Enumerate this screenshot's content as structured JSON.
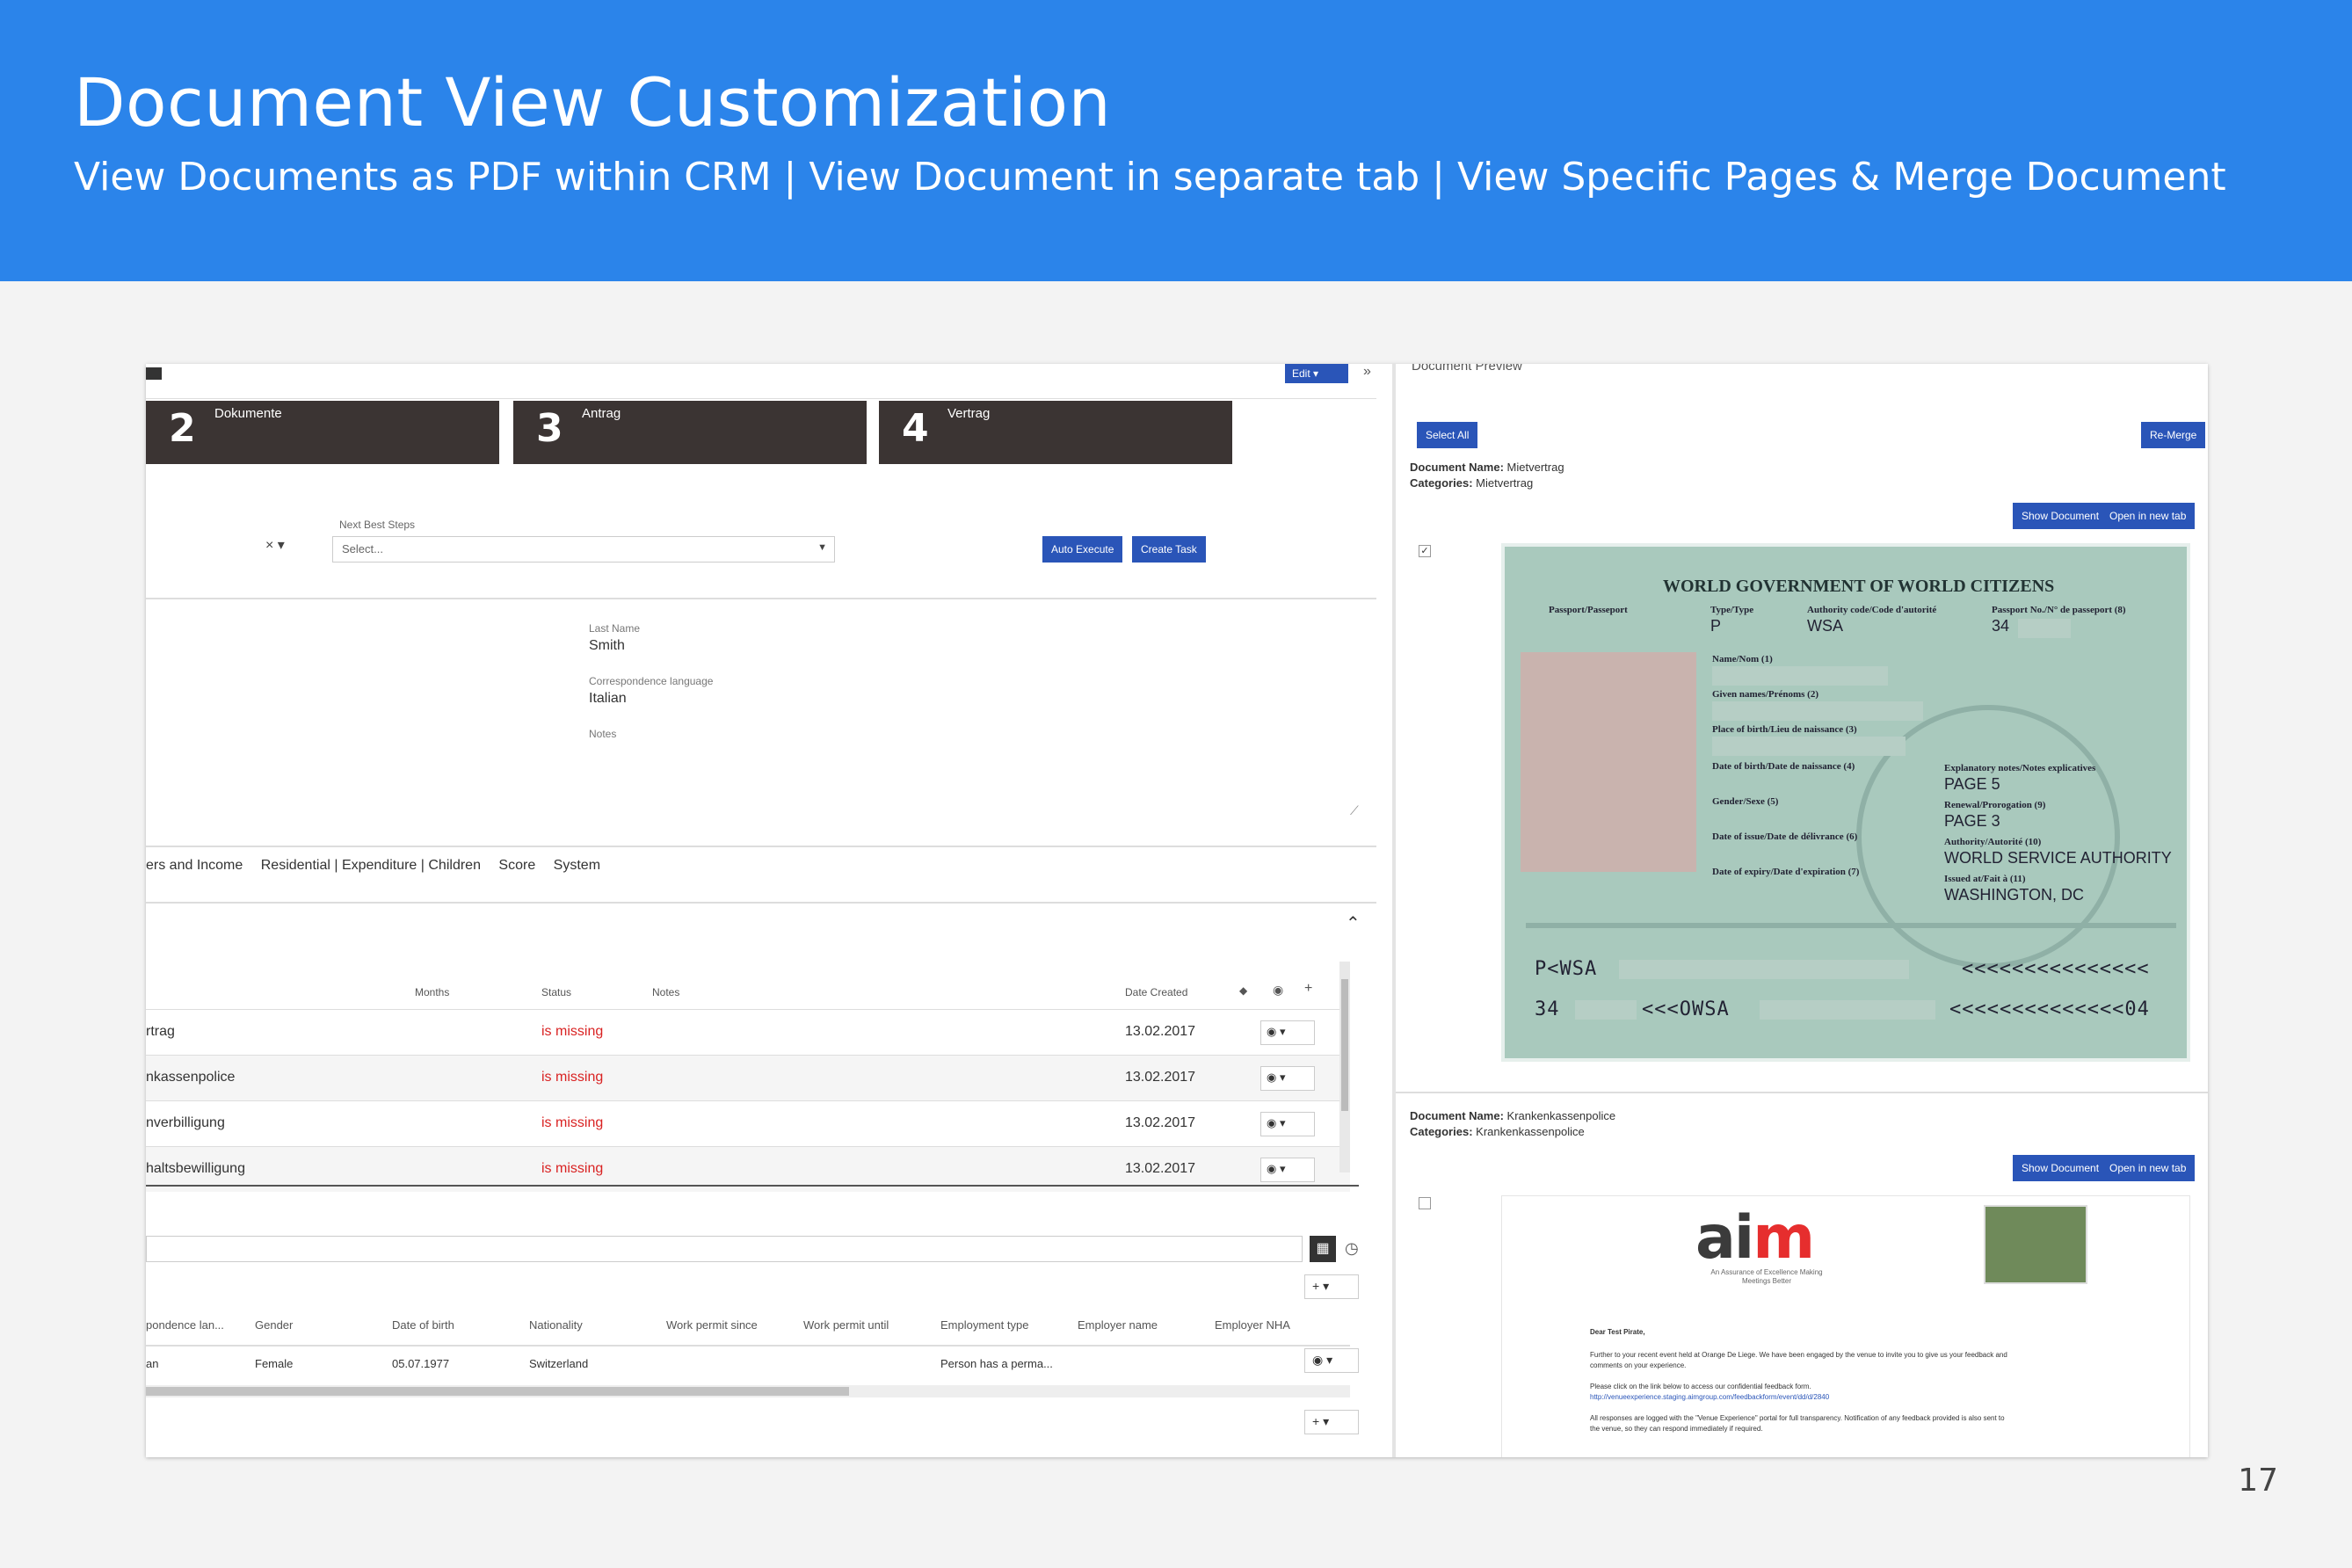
{
  "slide": {
    "title": "Document View Customization",
    "subtitle": "View Documents as PDF within CRM | View Document in separate tab | View Specific Pages & Merge Document",
    "page_number": "17",
    "accent_color": "#2b84ea"
  },
  "crm": {
    "top_bar": {
      "edit_label": "Edit",
      "expand_icon": "»"
    },
    "stages": [
      {
        "number": "2",
        "label": "Dokumente"
      },
      {
        "number": "3",
        "label": "Antrag"
      },
      {
        "number": "4",
        "label": "Vertrag"
      }
    ],
    "next_best_steps": {
      "label": "Next Best Steps",
      "placeholder": "Select...",
      "clear_icon": "× ▾",
      "auto_execute_label": "Auto Execute",
      "create_task_label": "Create Task"
    },
    "details": {
      "last_name_label": "Last Name",
      "last_name_value": "Smith",
      "language_label": "Correspondence language",
      "language_value": "Italian",
      "notes_label": "Notes"
    },
    "tabs": [
      "ers and Income",
      "Residential | Expenditure | Children",
      "Score",
      "System"
    ],
    "documents_table": {
      "headers": {
        "months": "Months",
        "status": "Status",
        "notes": "Notes",
        "date_created": "Date Created"
      },
      "rows": [
        {
          "name": "rtrag",
          "status": "is missing",
          "date": "13.02.2017"
        },
        {
          "name": "nkassenpolice",
          "status": "is missing",
          "date": "13.02.2017"
        },
        {
          "name": "nverbilligung",
          "status": "is missing",
          "date": "13.02.2017"
        },
        {
          "name": "haltsbewilligung",
          "status": "is missing",
          "date": "13.02.2017"
        }
      ]
    },
    "persons_table": {
      "headers": [
        "pondence lan...",
        "Gender",
        "Date of birth",
        "Nationality",
        "Work permit since",
        "Work permit until",
        "Employment type",
        "Employer name",
        "Employer NHA"
      ],
      "row": {
        "col0": "an",
        "gender": "Female",
        "dob": "05.07.1977",
        "nationality": "Switzerland",
        "employment": "Person has a perma..."
      }
    }
  },
  "preview": {
    "title": "Document Preview",
    "select_all_label": "Select All",
    "re_merge_label": "Re-Merge",
    "show_document_label": "Show Document",
    "open_new_tab_label": "Open in new tab",
    "documents": [
      {
        "name_label": "Document Name:",
        "name_value": "Mietvertrag",
        "category_label": "Categories:",
        "category_value": "Mietvertrag"
      },
      {
        "name_label": "Document Name:",
        "name_value": "Krankenkassenpolice",
        "category_label": "Categories:",
        "category_value": "Krankenkassenpolice"
      }
    ],
    "passport": {
      "title": "WORLD GOVERNMENT OF WORLD CITIZENS",
      "passport_label": "Passport/Passeport",
      "type_label": "Type/Type",
      "type_value": "P",
      "authority_label": "Authority code/Code d'autorité",
      "authority_value": "WSA",
      "number_label": "Passport No./N° de passeport (8)",
      "number_value": "34",
      "surname_label": "Name/Nom (1)",
      "given_label": "Given names/Prénoms (2)",
      "pob_label": "Place of birth/Lieu de naissance (3)",
      "dob_label": "Date of birth/Date de naissance (4)",
      "gender_label": "Gender/Sexe (5)",
      "issue_label": "Date of issue/Date de délivrance (6)",
      "expiry_label": "Date of expiry/Date d'expiration (7)",
      "notes_label": "Explanatory notes/Notes explicatives",
      "notes_value": "PAGE 5",
      "renewal_label": "Renewal/Prorogation (9)",
      "renewal_value": "PAGE 3",
      "auth_label": "Authority/Autorité (10)",
      "auth_value": "WORLD SERVICE AUTHORITY",
      "issued_label": "Issued at/Fait à (11)",
      "issued_value": "WASHINGTON, DC",
      "mrz1_left": "P<WSA",
      "mrz1_right": "<<<<<<<<<<<<<<<",
      "mrz2_left": "34",
      "mrz2_mid": "<<<OWSA",
      "mrz2_right": "<<<<<<<<<<<<<<04"
    },
    "letter": {
      "logo_main": "ai",
      "logo_accent": "m",
      "tagline": "An Assurance of Excellence Making Meetings Better",
      "greeting": "Dear Test Pirate,",
      "line1": "Further to your recent event held at Orange De Liege. We have been engaged by the venue to invite you to give us your feedback and",
      "line1b": "comments on your experience.",
      "line2": "Please click on the link below to access our confidential feedback form.",
      "link": "http://venueexperience.staging.aimgroup.com/feedbackform/event/dd/d/2840",
      "line3": "All responses are logged with the \"Venue Experience\" portal for full transparency. Notification of any feedback provided is also sent to",
      "line3b": "the venue, so they can respond immediately if required."
    }
  }
}
